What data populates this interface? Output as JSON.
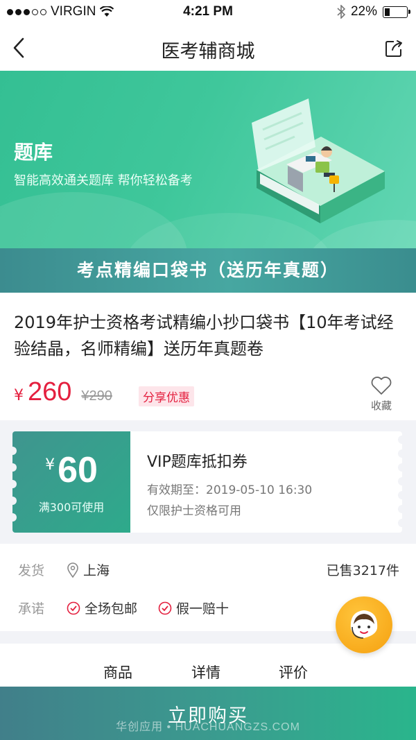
{
  "status": {
    "carrier": "VIRGIN",
    "time": "4:21 PM",
    "battery": "22%"
  },
  "nav": {
    "title": "医考辅商城"
  },
  "banner": {
    "title": "题库",
    "subtitle": "智能高效通关题库 帮你轻松备考"
  },
  "ribbon": {
    "text": "考点精编口袋书（送历年真题）"
  },
  "product": {
    "title": "2019年护士资格考试精编小抄口袋书【10年考试经验结晶，名师精编】送历年真题卷",
    "currency": "¥",
    "price": "260",
    "old_price": "¥290",
    "share_tag": "分享优惠",
    "fav_label": "收藏"
  },
  "coupon": {
    "currency": "¥",
    "amount": "60",
    "condition": "满300可使用",
    "title": "VIP题库抵扣券",
    "expiry": "有效期至：2019-05-10 16:30",
    "limit": "仅限护士资格可用"
  },
  "shipping": {
    "ship_label": "发货",
    "ship_from": "上海",
    "sold": "已售3217件",
    "promise_label": "承诺",
    "promise_1": "全场包邮",
    "promise_2": "假一赔十"
  },
  "tabs": [
    "商品",
    "详情",
    "评价"
  ],
  "buy": {
    "label": "立即购买",
    "watermark": "华创应用 • HUACHUANGZS.COM"
  },
  "colors": {
    "accent_green": "#2eaa8b",
    "price_red": "#e4203f",
    "service_orange": "#f5a00f"
  }
}
